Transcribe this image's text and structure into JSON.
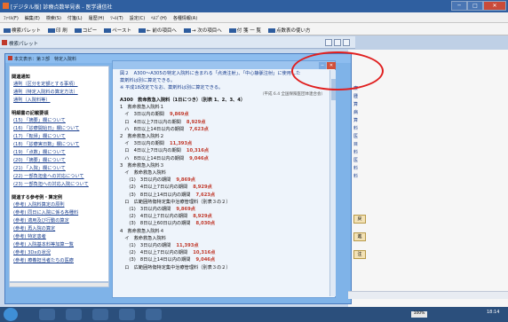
{
  "window": {
    "title": "[デジタル版] 診療点数早見表 - 医学通信社",
    "minimize": "─",
    "maximize": "□",
    "close": "✕"
  },
  "menu": [
    "ﾌｧｲﾙ(F)",
    "編集(E)",
    "検索(S)",
    "付箋(L)",
    "履歴(H)",
    "ﾂｰﾙ(T)",
    "設定(C)",
    "ﾍﾙﾌﾟ(H)",
    "各種情報(A)"
  ],
  "toolbar": {
    "items": [
      "検索パレット",
      "印 刷",
      "コピー",
      "ペースト",
      "← 前の項目へ",
      "→ 次の項目へ",
      "付 箋 一 覧",
      "点数表の使い方"
    ]
  },
  "palette": {
    "title": "検索パレット"
  },
  "subwindow": {
    "title": "本文表示：第３部　特定入院料"
  },
  "left_pane": {
    "sections": [
      {
        "heading": "関連通知",
        "links": [
          "通則（区分を定額とする事項）",
          "通則（特定入院料の算定方法）",
          "通則（入院料等）"
        ]
      },
      {
        "heading": "明細書の記載要領",
        "links": [
          "(15) 「摘要」欄について",
          "(16) 「診療開始日」欄について",
          "(17) 「転帰」欄について",
          "(18) 「診療実日数」欄について",
          "(19) 「点数」欄について",
          "(20) 「摘要」欄について",
          "(21) 「入院」欄について",
          "(22) 一部負担金への対応について",
          "(23) 一部負担への対応入院について"
        ]
      },
      {
        "heading": "関連する参考例・算定例",
        "links": [
          "(参考) 入院料算定の原則",
          "(参考) 同日に入院に係る各種料",
          "(参考) 適用及び行動の算定",
          "(参考) 再入院の算定",
          "(参考) 特定患者",
          "(参考) 入院基本料等加算一覧",
          "(参考) 3Dxの状況",
          "(参考) 療養担当者たちの医療"
        ]
      }
    ]
  },
  "content": {
    "note_line1": "図２　A300～A305の特定入院料に含まれる「点滴注射」、「中心静脈注射」に使用した",
    "note_line2": "薬剤料は別に算定できる。",
    "note_line3": "※ 平成18改定でなお、薬剤料は別に算定できる。",
    "source": "（平成 6.4 全国保険医団体連合会）",
    "heading": "A300　救命救急入院料（1日につき）（別表 1、2、3、4）",
    "rows": [
      {
        "text": "1　救命救急入院料１",
        "pts": ""
      },
      {
        "text": "　イ　3日以内の期間",
        "pts": "9,869点"
      },
      {
        "text": "　ロ　4日以上7日以内の期間",
        "pts": "8,929点"
      },
      {
        "text": "　ハ　8日以上14日以内の期間",
        "pts": "7,623点"
      },
      {
        "text": "2　救命救急入院料２",
        "pts": ""
      },
      {
        "text": "　イ　3日以内の期間",
        "pts": "11,393点"
      },
      {
        "text": "　ロ　4日以上7日以内の期間",
        "pts": "10,316点"
      },
      {
        "text": "　ハ　8日以上14日以内の期間",
        "pts": "9,046点"
      },
      {
        "text": "3　救命救急入院料３",
        "pts": ""
      },
      {
        "text": "　イ　救命救急入院料",
        "pts": ""
      },
      {
        "text": "　　(1)　3日以内の期間",
        "pts": "9,869点"
      },
      {
        "text": "　　(2)　4日以上7日以内の期間",
        "pts": "8,929点"
      },
      {
        "text": "　　(3)　8日以上14日以内の期間",
        "pts": "7,623点"
      },
      {
        "text": "　ロ　広範囲熱傷特定集中治療管理料（別表３の２）",
        "pts": ""
      },
      {
        "text": "　　(1)　3日以内の期間",
        "pts": "9,869点"
      },
      {
        "text": "　　(2)　4日以上7日以内の期間",
        "pts": "8,929点"
      },
      {
        "text": "　　(3)　8日以上60日以内の期間",
        "pts": "8,030点"
      },
      {
        "text": "4　救命救急入院料４",
        "pts": ""
      },
      {
        "text": "　イ　救命救急入院料",
        "pts": ""
      },
      {
        "text": "　　(1)　3日以内の期間",
        "pts": "11,393点"
      },
      {
        "text": "　　(2)　4日以上7日以内の期間",
        "pts": "10,316点"
      },
      {
        "text": "　　(3)　8日以上14日以内の期間",
        "pts": "9,046点"
      },
      {
        "text": "　ロ　広範囲熱傷特定集中治療管理料（別表３の２）",
        "pts": ""
      }
    ]
  },
  "right_items": [
    "療",
    "腫",
    "算",
    "病",
    "算",
    "料",
    "医",
    "目",
    "料",
    "医",
    "料",
    "料"
  ],
  "side_buttons": [
    "戻",
    "進",
    "注"
  ],
  "status": {
    "zoom": "100%"
  },
  "taskbar": {
    "time": "18:14"
  },
  "colors": {
    "accent": "#2f5fa0",
    "points": "#c0392b",
    "link": "#1a3f8f",
    "annotation": "#e02020"
  }
}
